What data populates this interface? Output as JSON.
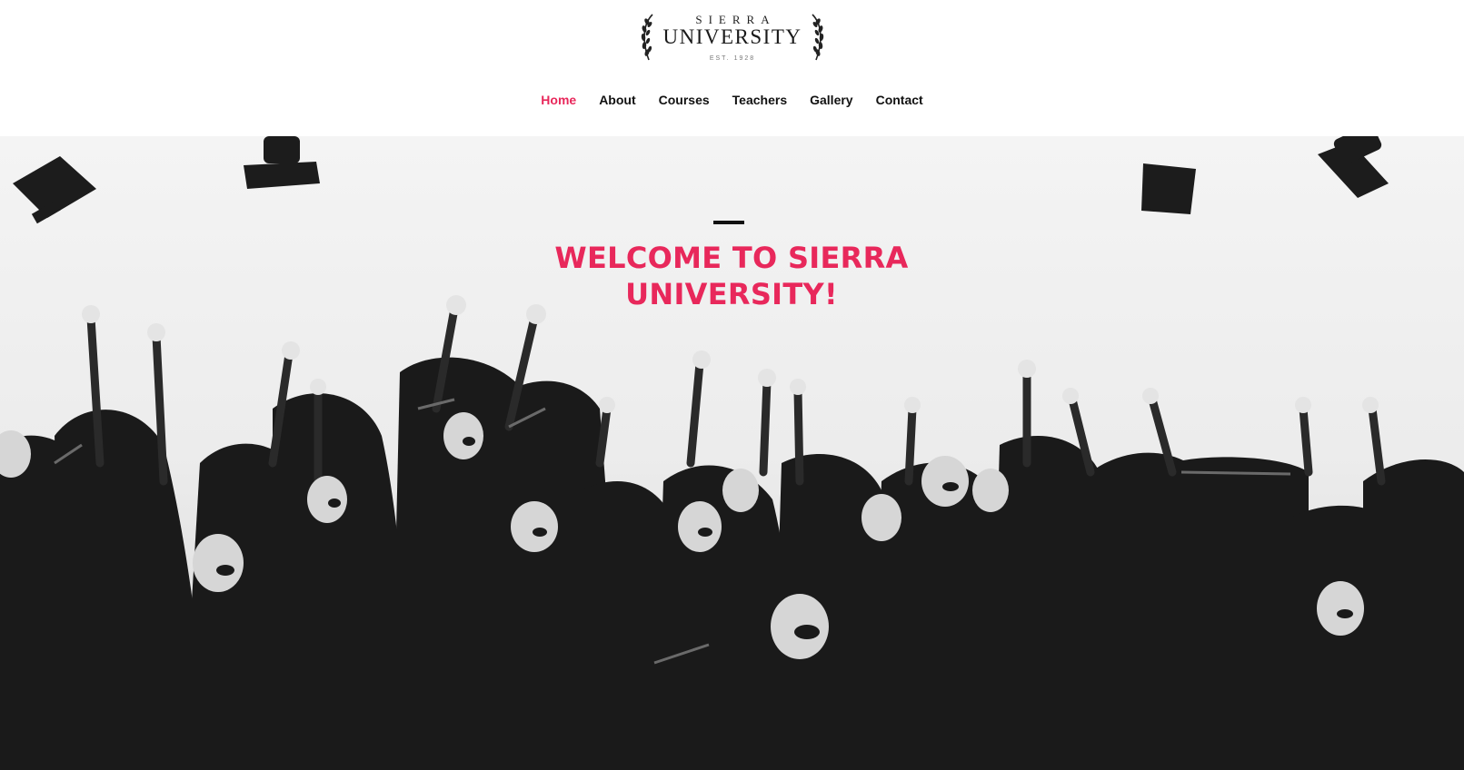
{
  "brand": {
    "logo_top": "SIERRA",
    "logo_main": "UNIVERSITY",
    "logo_est": "EST. 1928",
    "accent_color": "#e8285b"
  },
  "nav": {
    "items": [
      {
        "label": "Home",
        "active": true
      },
      {
        "label": "About",
        "active": false
      },
      {
        "label": "Courses",
        "active": false
      },
      {
        "label": "Teachers",
        "active": false
      },
      {
        "label": "Gallery",
        "active": false
      },
      {
        "label": "Contact",
        "active": false
      }
    ]
  },
  "hero": {
    "title": "WELCOME TO SIERRA UNIVERSITY!",
    "image_description": ""
  }
}
